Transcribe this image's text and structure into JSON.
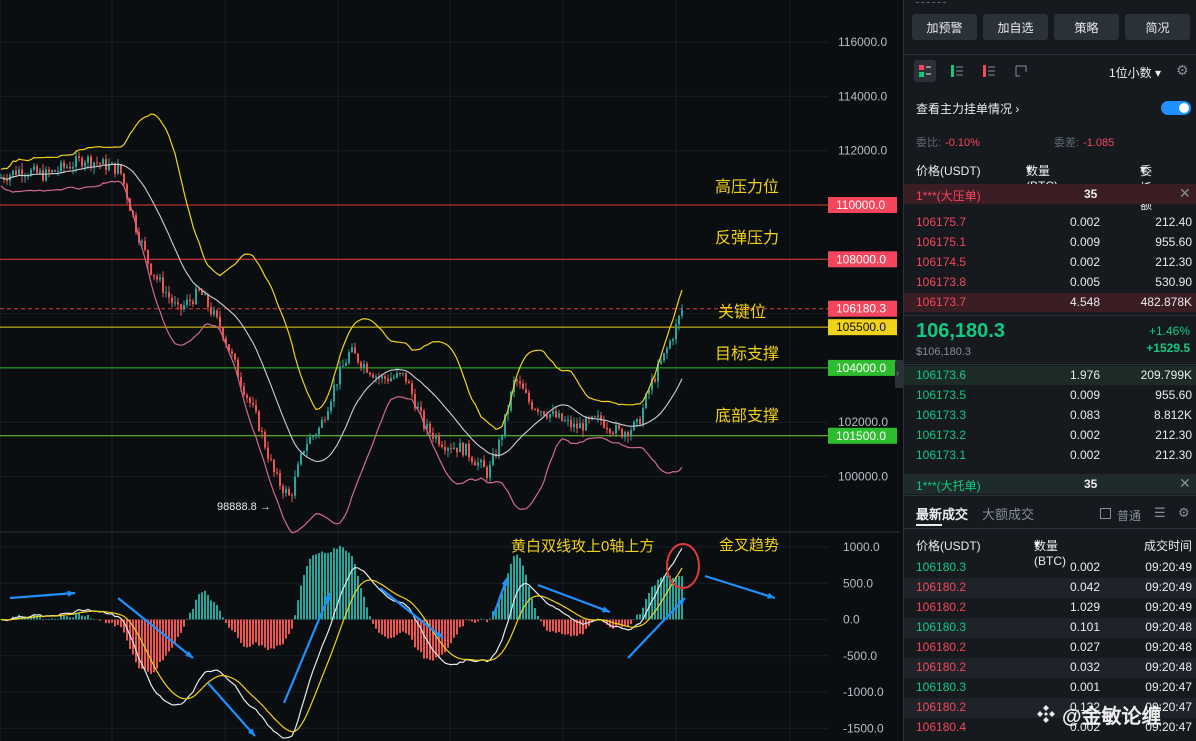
{
  "chart": {
    "price_axis": [
      "116000.0",
      "114000.0",
      "112000.0",
      "110000.0",
      "108000.0",
      "106180.3",
      "105500.0",
      "104000.0",
      "102000.0",
      "101500.0",
      "100000.0"
    ],
    "macd_axis": [
      "1000.0",
      "500.0",
      "0.0",
      "-500.0",
      "-1000.0",
      "-1500.0"
    ],
    "tags": [
      {
        "text": "110000.0",
        "color": "#f6465d",
        "price": 110000
      },
      {
        "text": "108000.0",
        "color": "#f6465d",
        "price": 108000
      },
      {
        "text": "106180.3",
        "color": "#f6465d",
        "price": 106180.3
      },
      {
        "text": "105500.0",
        "color": "#f0d21a",
        "price": 105500
      },
      {
        "text": "104000.0",
        "color": "#2ebd2e",
        "price": 104000
      },
      {
        "text": "101500.0",
        "color": "#2ebd2e",
        "price": 101500
      }
    ],
    "annotations": {
      "high_resistance": "高压力位",
      "rebound_resistance": "反弹压力",
      "key_level": "关键位",
      "target_support": "目标支撑",
      "bottom_support": "底部支撑",
      "low_marker": "98888.8",
      "macd_note": "黄白双线攻上0轴上方",
      "golden_cross": "金叉趋势"
    }
  },
  "panel": {
    "top_buttons": [
      "加预警",
      "加自选",
      "策略",
      "简况"
    ],
    "decimal_select": "1位小数",
    "depth_toggle_label": "查看主力挂单情况",
    "ratio_label": "委比:",
    "ratio_value": "-0.10%",
    "diff_label": "委差:",
    "diff_value": "-1.085",
    "headers": {
      "price": "价格(USDT)",
      "qty": "数量 (BTC)",
      "total": "委托额"
    },
    "big_ask": {
      "label": "1***(大压单)",
      "count": "35"
    },
    "big_bid": {
      "label": "1***(大托单)",
      "count": "35"
    },
    "asks": [
      {
        "price": "106175.7",
        "qty": "0.002",
        "total": "212.40"
      },
      {
        "price": "106175.1",
        "qty": "0.009",
        "total": "955.60"
      },
      {
        "price": "106174.5",
        "qty": "0.002",
        "total": "212.30"
      },
      {
        "price": "106173.8",
        "qty": "0.005",
        "total": "530.90"
      },
      {
        "price": "106173.7",
        "qty": "4.548",
        "total": "482.878K"
      }
    ],
    "last_price": "106,180.3",
    "last_price_usd": "$106,180.3",
    "change_pct": "+1.46%",
    "change_abs": "+1529.5",
    "bids": [
      {
        "price": "106173.6",
        "qty": "1.976",
        "total": "209.799K"
      },
      {
        "price": "106173.5",
        "qty": "0.009",
        "total": "955.60"
      },
      {
        "price": "106173.3",
        "qty": "0.083",
        "total": "8.812K"
      },
      {
        "price": "106173.2",
        "qty": "0.002",
        "total": "212.30"
      },
      {
        "price": "106173.1",
        "qty": "0.002",
        "total": "212.30"
      }
    ],
    "trade_tab_latest": "最新成交",
    "trade_tab_large": "大额成交",
    "normal_label": "普通",
    "trade_headers": {
      "price": "价格(USDT)",
      "qty": "数量(BTC)",
      "time": "成交时间"
    },
    "trades": [
      {
        "price": "106180.3",
        "qty": "0.002",
        "time": "09:20:49",
        "side": "g"
      },
      {
        "price": "106180.2",
        "qty": "0.042",
        "time": "09:20:49",
        "side": "r"
      },
      {
        "price": "106180.2",
        "qty": "1.029",
        "time": "09:20:49",
        "side": "r"
      },
      {
        "price": "106180.3",
        "qty": "0.101",
        "time": "09:20:48",
        "side": "g"
      },
      {
        "price": "106180.2",
        "qty": "0.027",
        "time": "09:20:48",
        "side": "r"
      },
      {
        "price": "106180.2",
        "qty": "0.032",
        "time": "09:20:48",
        "side": "r"
      },
      {
        "price": "106180.3",
        "qty": "0.001",
        "time": "09:20:47",
        "side": "g"
      },
      {
        "price": "106180.2",
        "qty": "0.132",
        "time": "09:20:47",
        "side": "r"
      },
      {
        "price": "106180.4",
        "qty": "0.002",
        "time": "09:20:47",
        "side": "r"
      }
    ],
    "watermark": "@金敏论缠"
  }
}
